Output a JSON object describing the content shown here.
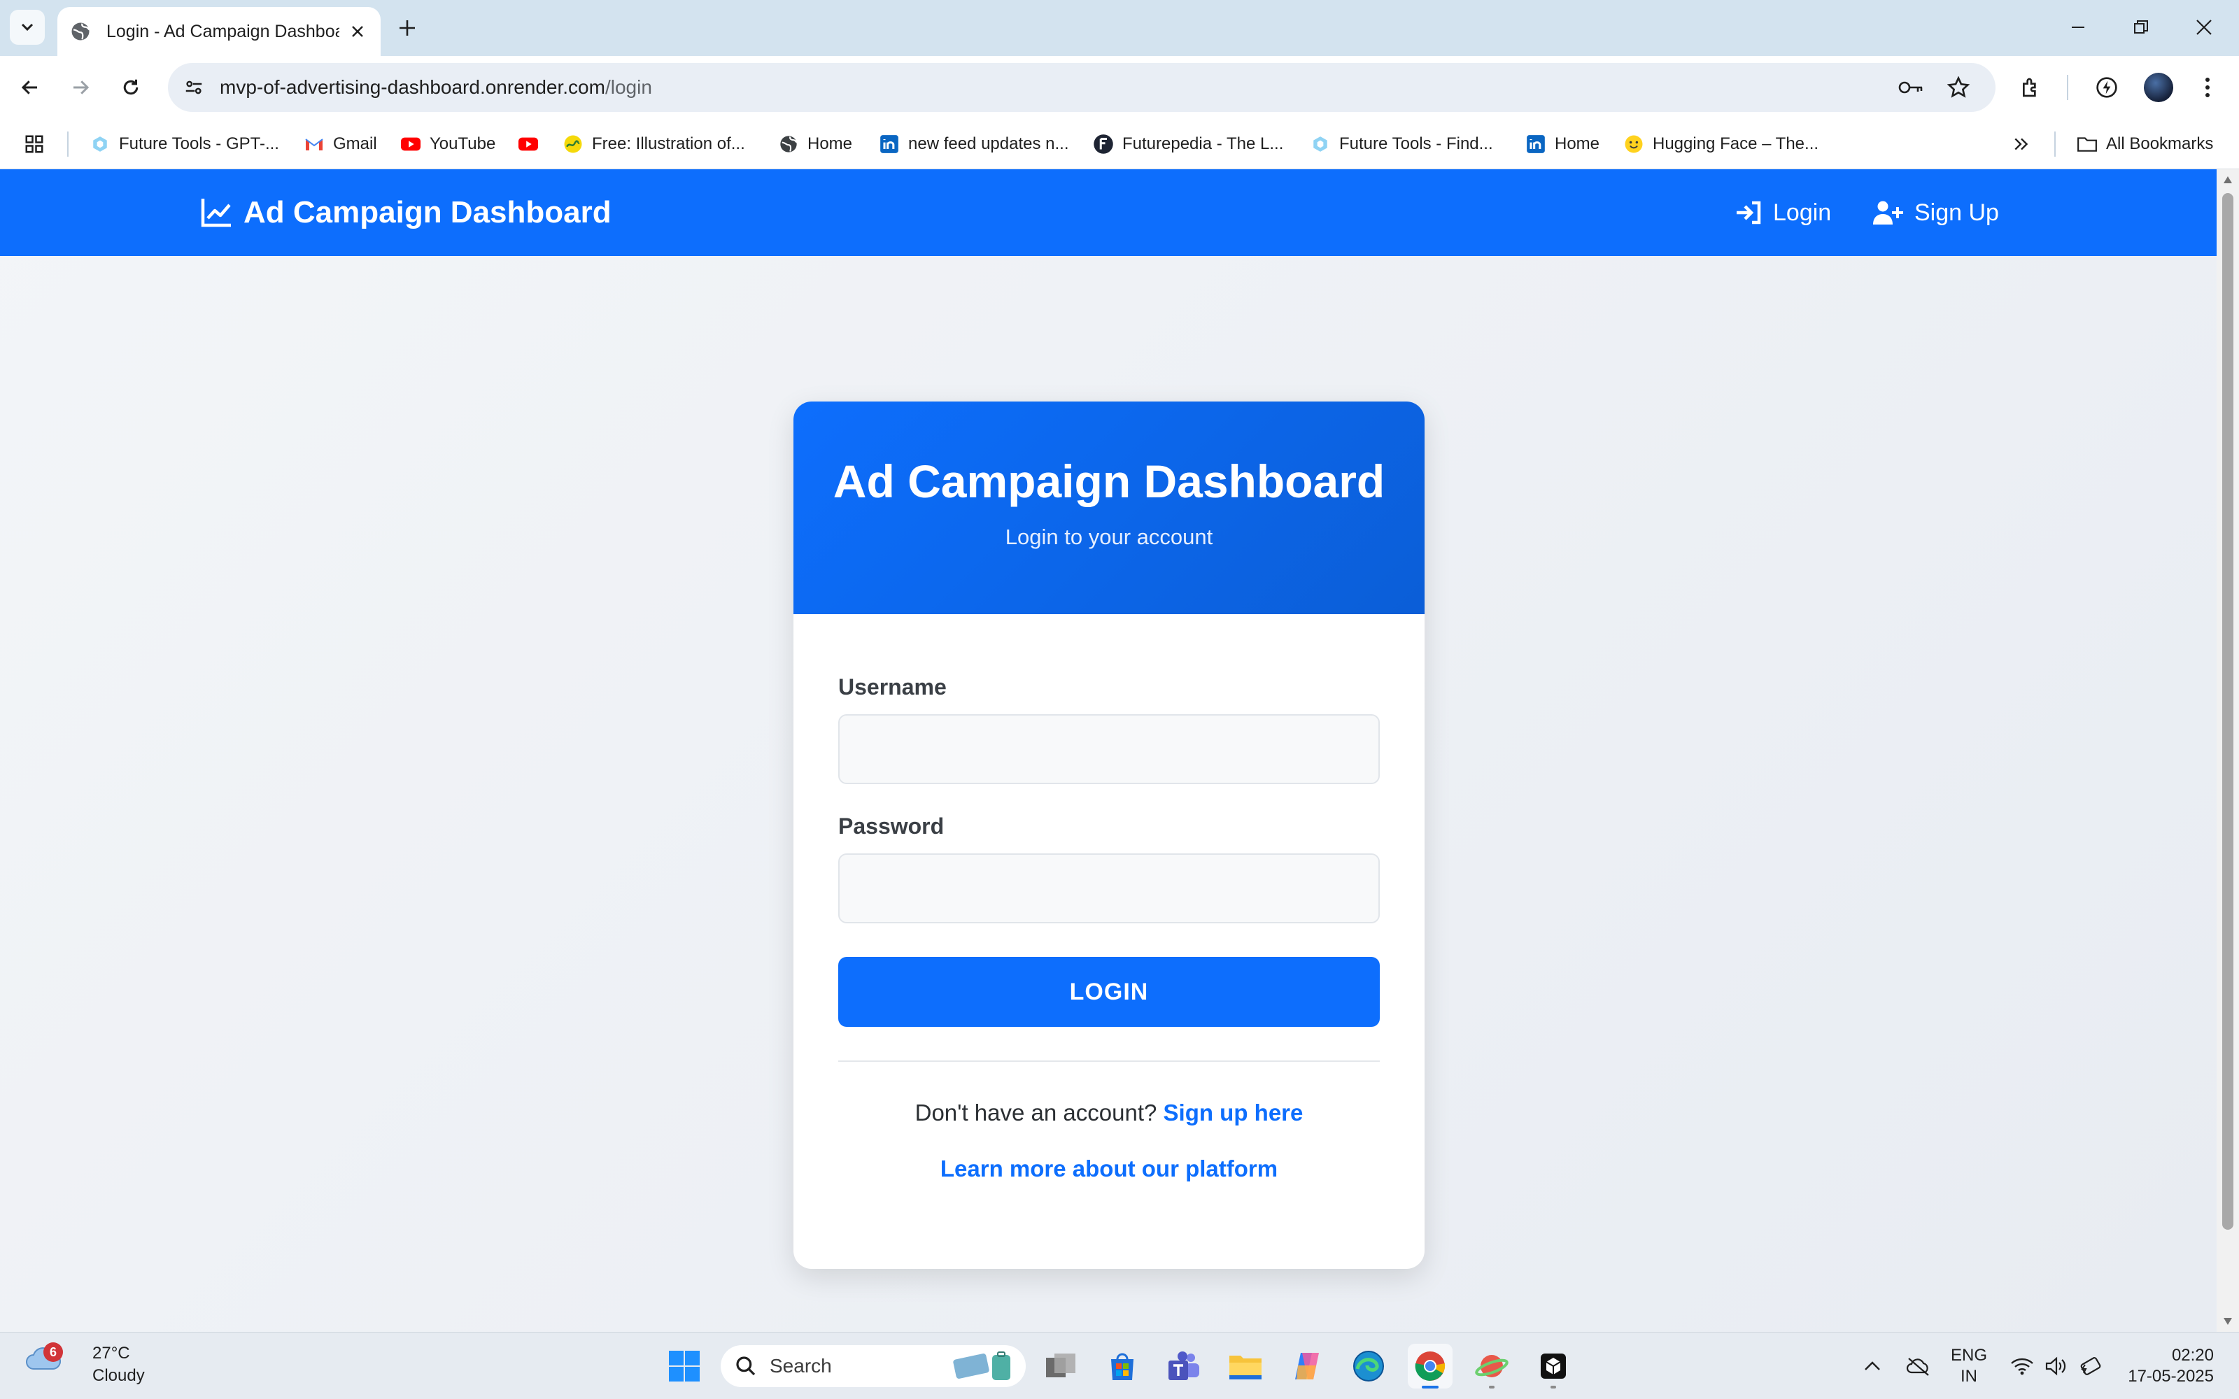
{
  "browser": {
    "tab_title": "Login - Ad Campaign Dashboard",
    "url_domain": "mvp-of-advertising-dashboard.onrender.com",
    "url_path": "/login",
    "bookmarks": [
      {
        "label": "Future Tools - GPT-...",
        "icon": "future-tools-icon"
      },
      {
        "label": "Gmail",
        "icon": "gmail-icon"
      },
      {
        "label": "YouTube",
        "icon": "youtube-icon"
      },
      {
        "label": "",
        "icon": "youtube-icon"
      },
      {
        "label": "Free: Illustration of...",
        "icon": "illustration-icon"
      },
      {
        "label": "Home",
        "icon": "globe-icon"
      },
      {
        "label": "new feed updates n...",
        "icon": "linkedin-icon"
      },
      {
        "label": "Futurepedia - The L...",
        "icon": "futurepedia-icon"
      },
      {
        "label": "Future Tools - Find...",
        "icon": "future-tools-icon"
      },
      {
        "label": "Home",
        "icon": "linkedin-icon"
      },
      {
        "label": "Hugging Face – The...",
        "icon": "hugging-face-icon"
      }
    ],
    "all_bookmarks_label": "All Bookmarks"
  },
  "app": {
    "brand": "Ad Campaign Dashboard",
    "nav": {
      "login": "Login",
      "signup": "Sign Up"
    },
    "accent_color": "#0d6efd"
  },
  "login": {
    "title": "Ad Campaign Dashboard",
    "subtitle": "Login to your account",
    "username_label": "Username",
    "username_value": "",
    "password_label": "Password",
    "password_value": "",
    "submit_label": "LOGIN",
    "no_account_text": "Don't have an account?",
    "signup_link": "Sign up here",
    "learn_more_link": "Learn more about our platform"
  },
  "taskbar": {
    "weather_temp": "27°C",
    "weather_desc": "Cloudy",
    "weather_badge": "6",
    "search_placeholder": "Search",
    "lang_line1": "ENG",
    "lang_line2": "IN",
    "time": "02:20",
    "date": "17-05-2025"
  }
}
